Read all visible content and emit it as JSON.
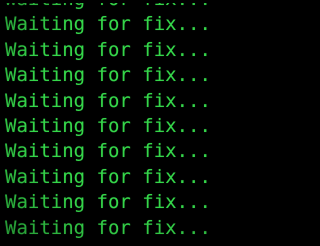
{
  "terminal": {
    "text_color": "#35d64a",
    "background_color": "#000000",
    "lines": [
      "Waiting for fix...",
      "Waiting for fix...",
      "Waiting for fix...",
      "Waiting for fix...",
      "Waiting for fix...",
      "Waiting for fix...",
      "Waiting for fix...",
      "Waiting for fix...",
      "Waiting for fix...",
      "Waiting for fix..."
    ]
  }
}
